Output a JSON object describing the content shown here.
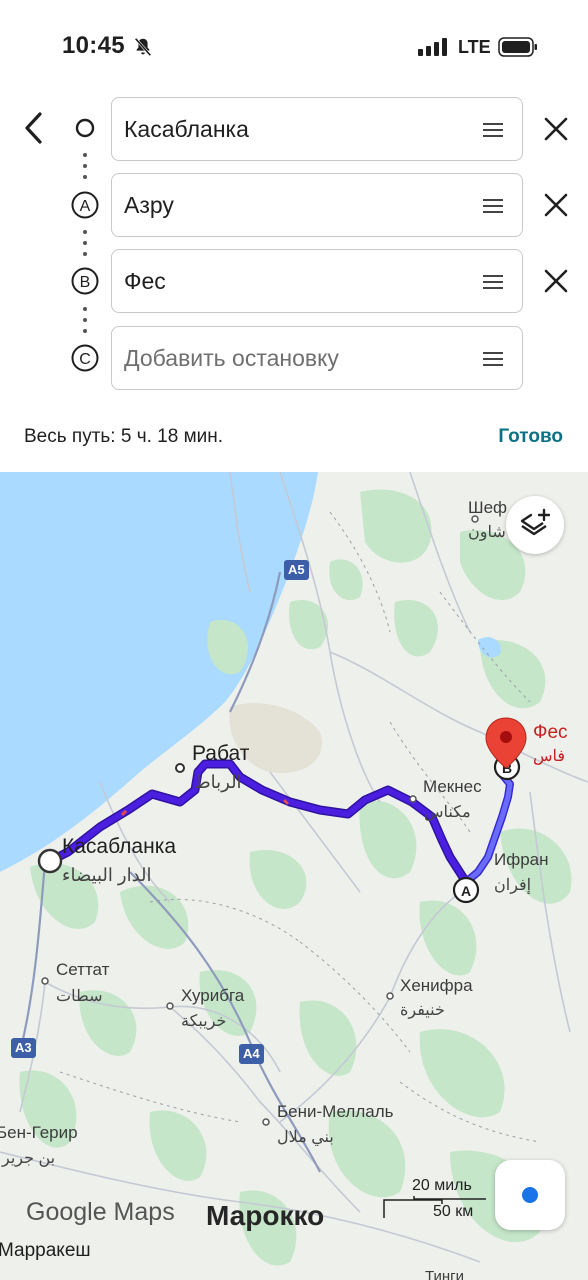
{
  "status": {
    "time": "10:45",
    "network": "LTE"
  },
  "route": {
    "stops": [
      {
        "marker": "",
        "value": "Касабланка",
        "placeholder": ""
      },
      {
        "marker": "A",
        "value": "Азру",
        "placeholder": ""
      },
      {
        "marker": "B",
        "value": "Фес",
        "placeholder": ""
      },
      {
        "marker": "C",
        "value": "",
        "placeholder": "Добавить остановку"
      }
    ],
    "summary": "Весь путь: 5 ч. 18 мин.",
    "done_label": "Готово"
  },
  "map": {
    "labels": {
      "rabat": "Рабат",
      "rabat_ar": "الرباط",
      "casablanca": "Касабланка",
      "casablanca_ar": "الدار البيضاء",
      "meknes": "Мекнес",
      "meknes_ar": "مكناس",
      "fes": "Фес",
      "fes_ar": "فاس",
      "ifrane": "Ифран",
      "ifrane_ar": "إفران",
      "settat": "Сеттат",
      "settat_ar": "سطات",
      "khouribga": "Хурибга",
      "khouribga_ar": "خريبكة",
      "khenifra": "Хенифра",
      "khenifra_ar": "خنيفرة",
      "beni_mellal": "Бени-Меллаль",
      "beni_mellal_ar": "بني ملال",
      "ben_guerir": "Бен-Герир",
      "ben_guerir_ar": "بن جرير",
      "chefchaouen": "Шеф",
      "chefchaouen_ar": "شاون",
      "marrakesh": "Марракеш",
      "country": "Марокко",
      "partial_bottom": "Тинги"
    },
    "shields": {
      "a5": "A5",
      "a3": "A3",
      "a4": "A4"
    },
    "route_markers": {
      "a": "A",
      "b": "B"
    },
    "logo": "Google Maps",
    "scale": {
      "miles": "20 миль",
      "km": "50 км"
    },
    "colors": {
      "route": "#4b1fe0",
      "water": "#aadaff",
      "land": "#eef0ec",
      "green": "#bfe3c4",
      "pin": "#ea4335",
      "accent": "#0b7285"
    }
  },
  "icons": {
    "back": "back-arrow-icon",
    "bell_off": "bell-off-icon",
    "layers": "layers-icon",
    "location": "my-location-icon"
  }
}
